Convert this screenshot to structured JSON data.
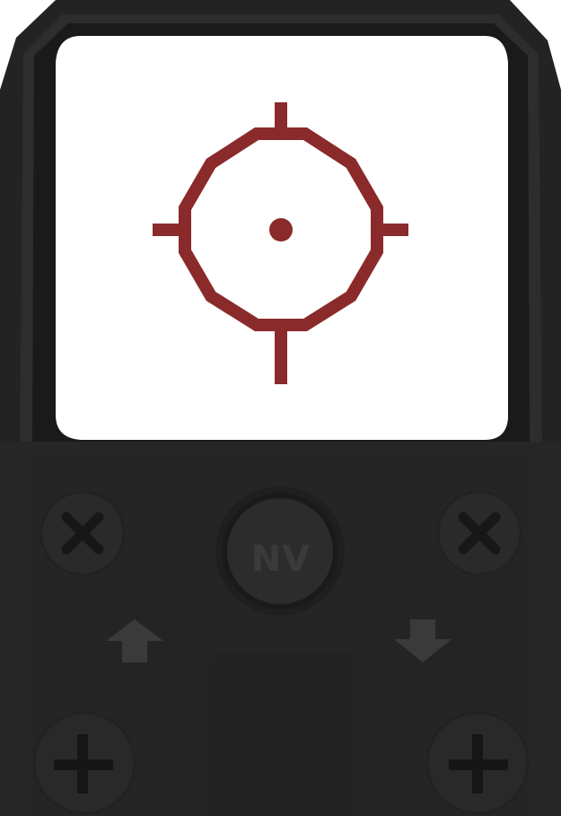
{
  "device": {
    "name": "red-dot-sight",
    "colors": {
      "housing": "#252525",
      "housing_edge": "#1b1b1b",
      "bevel": "#303030",
      "window": "#ffffff",
      "reticle": "#8b2a2a",
      "button_face": "#2c2c2c",
      "icon_dark": "#161616",
      "arrow": "#3c3c3c"
    }
  },
  "controls": {
    "nv_label": "NV"
  },
  "icons": {
    "screw_top_left": "x-screw-icon",
    "screw_top_right": "x-screw-icon",
    "screw_bottom_left": "plus-screw-icon",
    "screw_bottom_right": "plus-screw-icon",
    "brightness_up": "arrow-up-icon",
    "brightness_down": "arrow-down-icon"
  }
}
